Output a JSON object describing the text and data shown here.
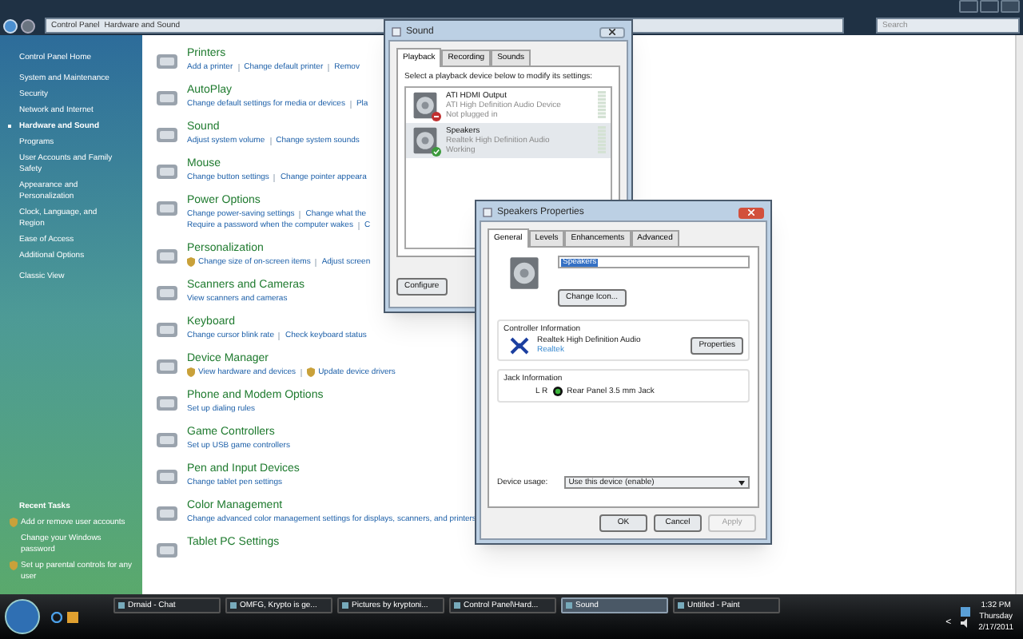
{
  "explorer": {
    "breadcrumb": [
      "Control Panel",
      "Hardware and Sound"
    ],
    "search": {
      "placeholder": "Search"
    },
    "sidebar": {
      "items": [
        {
          "label": "Control Panel Home",
          "selected": false
        },
        {
          "label": "System and Maintenance",
          "selected": false
        },
        {
          "label": "Security",
          "selected": false
        },
        {
          "label": "Network and Internet",
          "selected": false
        },
        {
          "label": "Hardware and Sound",
          "selected": true
        },
        {
          "label": "Programs",
          "selected": false
        },
        {
          "label": "User Accounts and Family Safety",
          "selected": false
        },
        {
          "label": "Appearance and Personalization",
          "selected": false
        },
        {
          "label": "Clock, Language, and Region",
          "selected": false
        },
        {
          "label": "Ease of Access",
          "selected": false
        },
        {
          "label": "Additional Options",
          "selected": false
        },
        {
          "label": "Classic View",
          "selected": false
        }
      ],
      "recent_tasks": {
        "title": "Recent Tasks",
        "items": [
          {
            "label": "Add or remove user accounts",
            "shield": true
          },
          {
            "label": "Change your Windows password",
            "shield": false
          },
          {
            "label": "Set up parental controls for any user",
            "shield": true
          }
        ]
      }
    },
    "categories": [
      {
        "title": "Printers",
        "lines": [
          [
            {
              "text": "Add a printer",
              "shield": false
            },
            {
              "text": "Change default printer",
              "shield": false
            },
            {
              "text": "Remov",
              "shield": false
            }
          ]
        ]
      },
      {
        "title": "AutoPlay",
        "lines": [
          [
            {
              "text": "Change default settings for media or devices",
              "shield": false
            },
            {
              "text": "Pla",
              "shield": false
            }
          ]
        ]
      },
      {
        "title": "Sound",
        "lines": [
          [
            {
              "text": "Adjust system volume",
              "shield": false
            },
            {
              "text": "Change system sounds",
              "shield": false
            }
          ]
        ]
      },
      {
        "title": "Mouse",
        "lines": [
          [
            {
              "text": "Change button settings",
              "shield": false
            },
            {
              "text": "Change pointer appeara",
              "shield": false
            }
          ]
        ]
      },
      {
        "title": "Power Options",
        "lines": [
          [
            {
              "text": "Change power-saving settings",
              "shield": false
            },
            {
              "text": "Change what the",
              "shield": false
            }
          ],
          [
            {
              "text": "Require a password when the computer wakes",
              "shield": false
            },
            {
              "text": "C",
              "shield": false
            }
          ]
        ]
      },
      {
        "title": "Personalization",
        "lines": [
          [
            {
              "text": "Change size of on-screen items",
              "shield": true
            },
            {
              "text": "Adjust screen",
              "shield": false
            }
          ]
        ]
      },
      {
        "title": "Scanners and Cameras",
        "lines": [
          [
            {
              "text": "View scanners and cameras",
              "shield": false
            }
          ]
        ]
      },
      {
        "title": "Keyboard",
        "lines": [
          [
            {
              "text": "Change cursor blink rate",
              "shield": false
            },
            {
              "text": "Check keyboard status",
              "shield": false
            }
          ]
        ]
      },
      {
        "title": "Device Manager",
        "lines": [
          [
            {
              "text": "View hardware and devices",
              "shield": true
            },
            {
              "text": "Update device drivers",
              "shield": true
            }
          ]
        ]
      },
      {
        "title": "Phone and Modem Options",
        "lines": [
          [
            {
              "text": "Set up dialing rules",
              "shield": false
            }
          ]
        ]
      },
      {
        "title": "Game Controllers",
        "lines": [
          [
            {
              "text": "Set up USB game controllers",
              "shield": false
            }
          ]
        ]
      },
      {
        "title": "Pen and Input Devices",
        "lines": [
          [
            {
              "text": "Change tablet pen settings",
              "shield": false
            }
          ]
        ]
      },
      {
        "title": "Color Management",
        "lines": [
          [
            {
              "text": "Change advanced color management settings for displays, scanners, and printers",
              "shield": false
            }
          ]
        ]
      },
      {
        "title": "Tablet PC Settings"
      }
    ]
  },
  "sound_dialog": {
    "title": "Sound",
    "tabs": [
      {
        "label": "Playback",
        "selected": true
      },
      {
        "label": "Recording",
        "selected": false
      },
      {
        "label": "Sounds",
        "selected": false
      }
    ],
    "instruction": "Select a playback device below to modify its settings:",
    "devices": [
      {
        "name": "ATI HDMI Output",
        "driver": "ATI High Definition Audio Device",
        "status": "Not plugged in",
        "kind": "unplugged",
        "selected": false
      },
      {
        "name": "Speakers",
        "driver": "Realtek High Definition Audio",
        "status": "Working",
        "kind": "working",
        "selected": true
      }
    ],
    "button": "Configure"
  },
  "properties_dialog": {
    "title": "Speakers Properties",
    "tabs": [
      {
        "label": "General",
        "selected": true
      },
      {
        "label": "Levels",
        "selected": false
      },
      {
        "label": "Enhancements",
        "selected": false
      },
      {
        "label": "Advanced",
        "selected": false
      }
    ],
    "name_field": {
      "value": "Speakers"
    },
    "change_icon_button": "Change Icon...",
    "controller": {
      "title": "Controller Information",
      "name": "Realtek High Definition Audio",
      "link": "Realtek",
      "button": "Properties"
    },
    "jack": {
      "title": "Jack Information",
      "channels": "L R",
      "name": "Rear Panel 3.5 mm Jack"
    },
    "usage": {
      "label": "Device usage:",
      "value": "Use this device (enable)"
    },
    "buttons": [
      {
        "label": "OK",
        "disabled": false
      },
      {
        "label": "Cancel",
        "disabled": false
      },
      {
        "label": "Apply",
        "disabled": true
      }
    ]
  },
  "taskbar": {
    "tasks": [
      {
        "label": "Drnaid - Chat",
        "selected": false
      },
      {
        "label": "OMFG, Krypto is ge...",
        "selected": false
      },
      {
        "label": "Pictures by kryptoni...",
        "selected": false
      },
      {
        "label": "Control Panel\\Hard...",
        "selected": false
      },
      {
        "label": "Sound",
        "selected": true
      },
      {
        "label": "Untitled - Paint",
        "selected": false
      }
    ],
    "tray_arrow": "<",
    "time": "1:32 PM",
    "day": "Thursday",
    "date": "2/17/2011"
  }
}
